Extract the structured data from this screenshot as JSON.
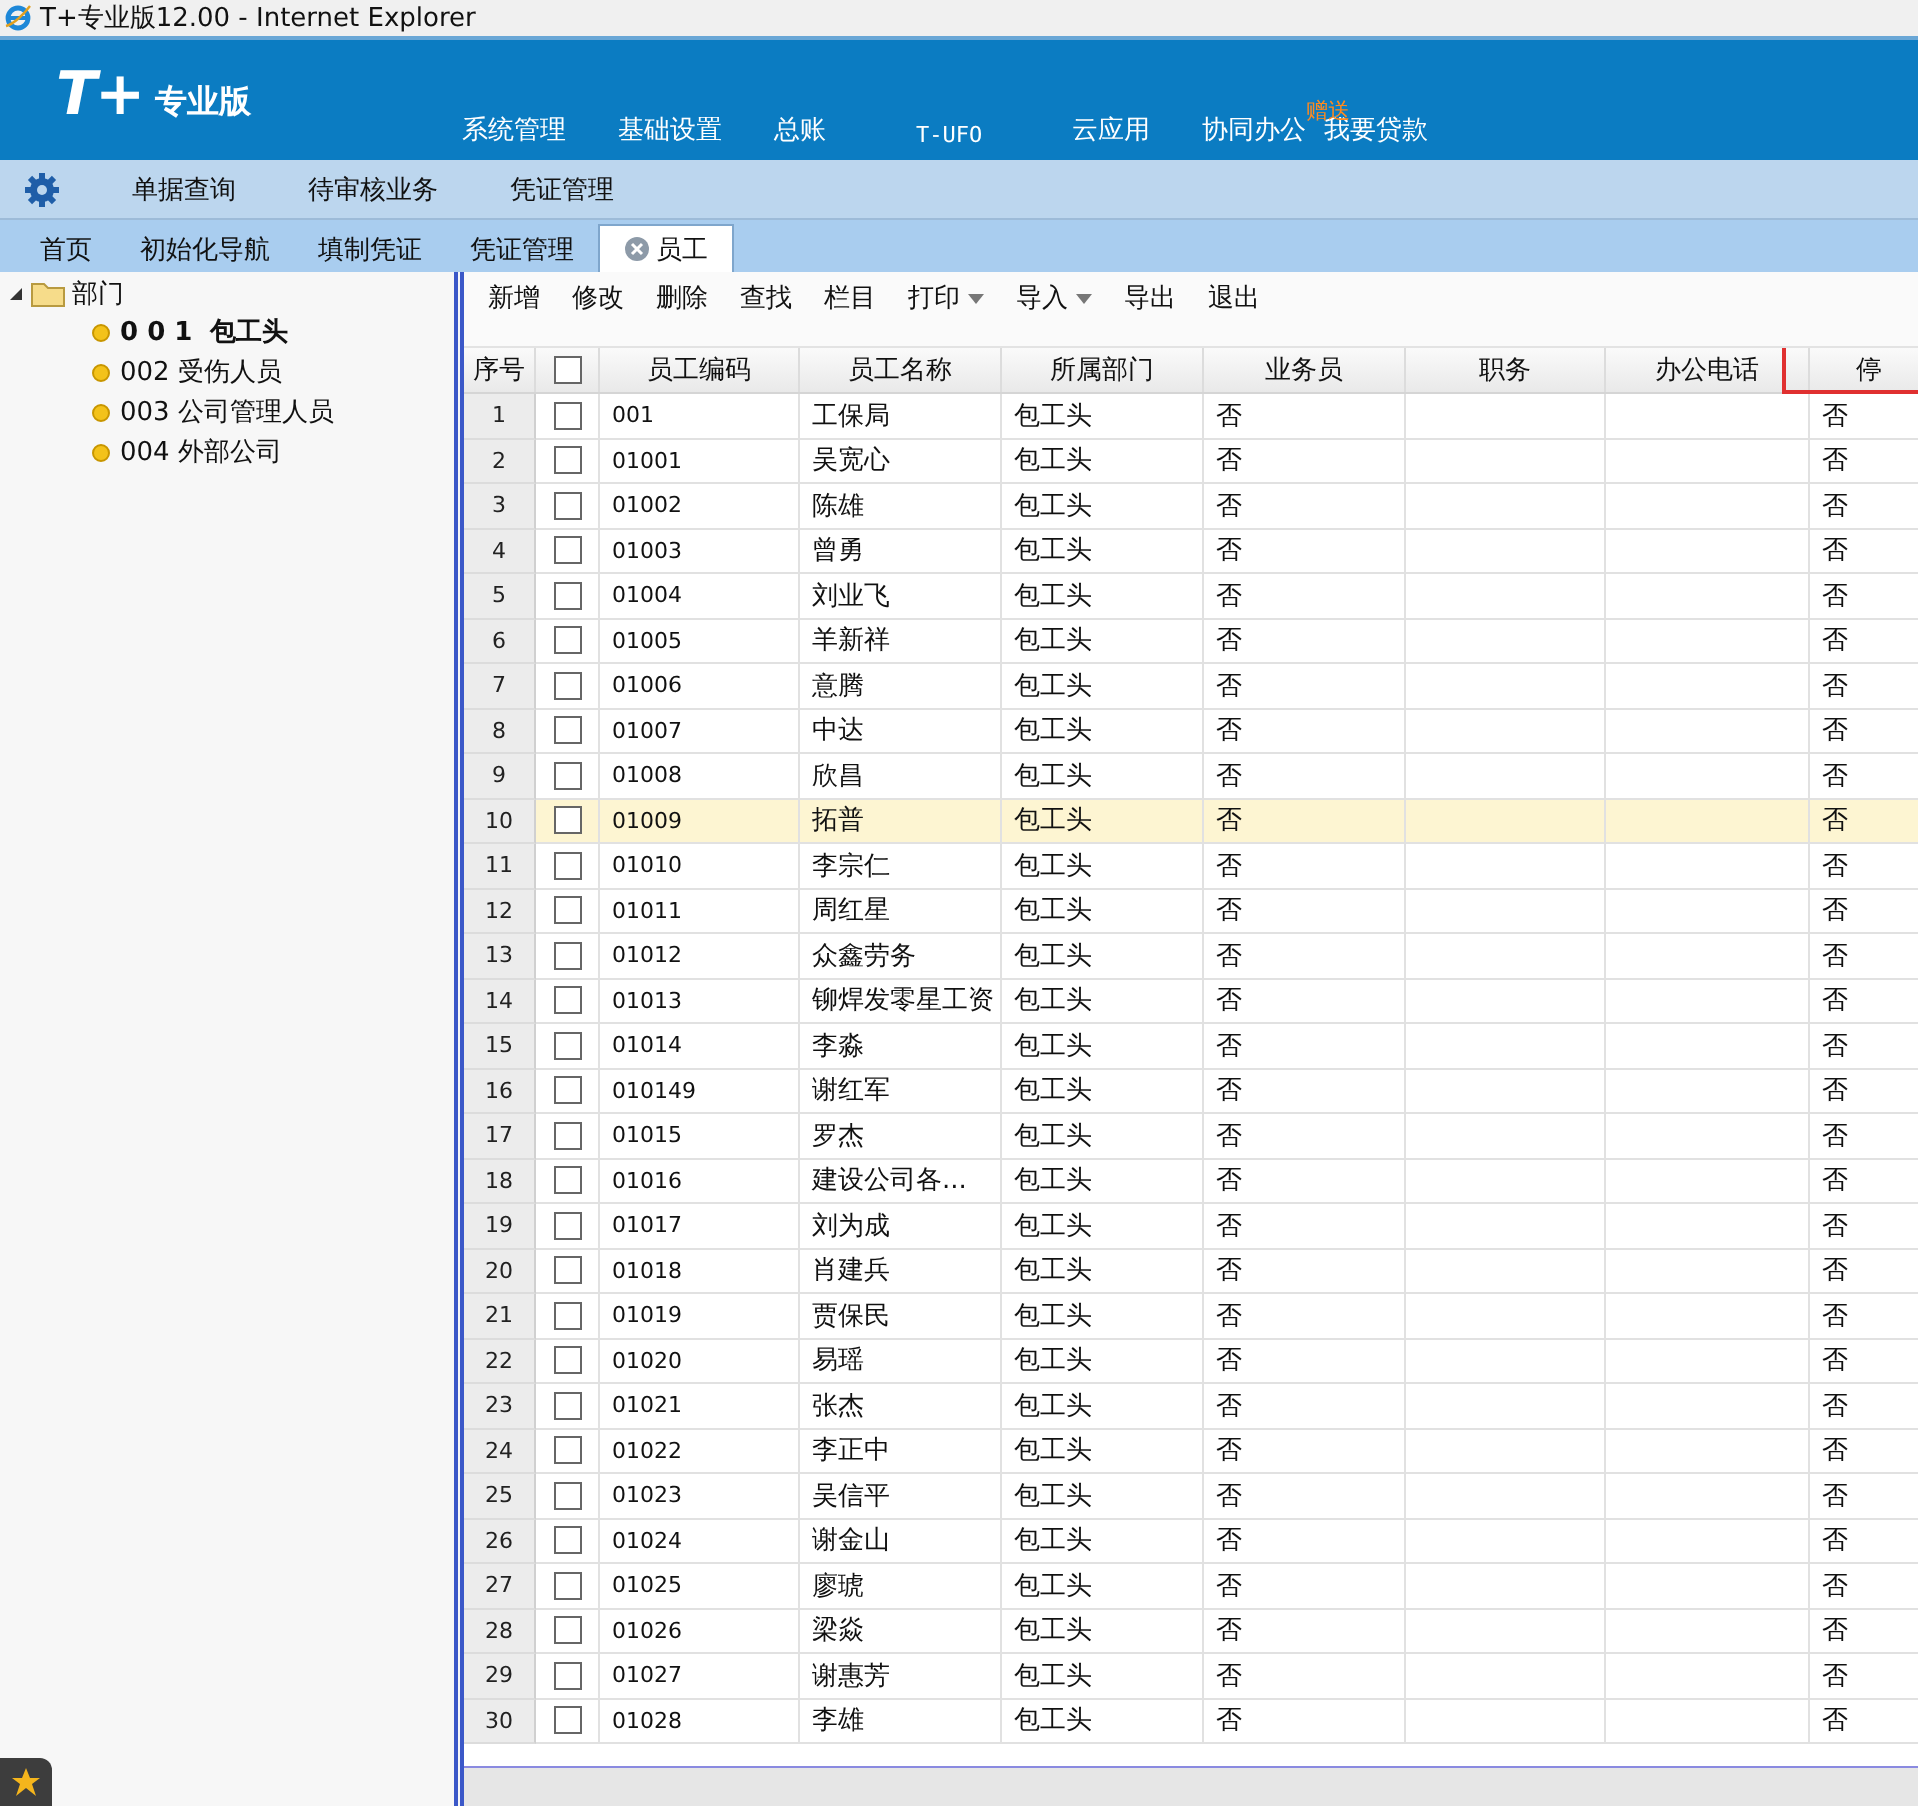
{
  "window": {
    "title": "T+专业版12.00 - Internet Explorer"
  },
  "header": {
    "logo": "T+",
    "edition": "专业版",
    "nav": [
      {
        "label": "系统管理"
      },
      {
        "label": "基础设置"
      },
      {
        "label": "总账"
      },
      {
        "label": "T-UFO",
        "kind": "mono"
      },
      {
        "label": "云应用"
      },
      {
        "label": "协同办公",
        "badge": "赠送"
      },
      {
        "label": "我要贷款"
      }
    ]
  },
  "subnav": [
    "单据查询",
    "待审核业务",
    "凭证管理"
  ],
  "tabs": [
    {
      "label": "首页",
      "selected": false
    },
    {
      "label": "初始化导航",
      "selected": false
    },
    {
      "label": "填制凭证",
      "selected": false
    },
    {
      "label": "凭证管理",
      "selected": false
    },
    {
      "label": "员工",
      "selected": true
    }
  ],
  "tree": {
    "label": "部门",
    "expanded": true,
    "children": [
      {
        "label": "0 0 1  包工头",
        "selected": true
      },
      {
        "label": "002 受伤人员",
        "selected": false
      },
      {
        "label": "003 公司管理人员",
        "selected": false
      },
      {
        "label": "004 外部公司",
        "selected": false
      }
    ]
  },
  "toolbar": [
    {
      "label": "新增"
    },
    {
      "label": "修改"
    },
    {
      "label": "删除"
    },
    {
      "label": "查找"
    },
    {
      "label": "栏目"
    },
    {
      "label": "打印",
      "dropdown": true
    },
    {
      "label": "导入",
      "dropdown": true
    },
    {
      "label": "导出"
    },
    {
      "label": "退出"
    }
  ],
  "table": {
    "columns": [
      "序号",
      "员工编码",
      "员工名称",
      "所属部门",
      "业务员",
      "职务",
      "办公电话",
      "停"
    ],
    "all_checked": false,
    "rows": [
      {
        "no": "1",
        "checked": false,
        "selected": false,
        "code": "001",
        "name": "工保局",
        "dept": "包工头",
        "salesman": "否",
        "col8": "否"
      },
      {
        "no": "2",
        "checked": false,
        "selected": false,
        "code": "01001",
        "name": "吴宽心",
        "dept": "包工头",
        "salesman": "否",
        "col8": "否"
      },
      {
        "no": "3",
        "checked": false,
        "selected": false,
        "code": "01002",
        "name": "陈雄",
        "dept": "包工头",
        "salesman": "否",
        "col8": "否"
      },
      {
        "no": "4",
        "checked": false,
        "selected": false,
        "code": "01003",
        "name": "曾勇",
        "dept": "包工头",
        "salesman": "否",
        "col8": "否"
      },
      {
        "no": "5",
        "checked": false,
        "selected": false,
        "code": "01004",
        "name": "刘业飞",
        "dept": "包工头",
        "salesman": "否",
        "col8": "否"
      },
      {
        "no": "6",
        "checked": false,
        "selected": false,
        "code": "01005",
        "name": "羊新祥",
        "dept": "包工头",
        "salesman": "否",
        "col8": "否"
      },
      {
        "no": "7",
        "checked": false,
        "selected": false,
        "code": "01006",
        "name": "意腾",
        "dept": "包工头",
        "salesman": "否",
        "col8": "否"
      },
      {
        "no": "8",
        "checked": false,
        "selected": false,
        "code": "01007",
        "name": "中达",
        "dept": "包工头",
        "salesman": "否",
        "col8": "否"
      },
      {
        "no": "9",
        "checked": false,
        "selected": false,
        "code": "01008",
        "name": "欣昌",
        "dept": "包工头",
        "salesman": "否",
        "col8": "否"
      },
      {
        "no": "10",
        "checked": false,
        "selected": true,
        "code": "01009",
        "name": "拓普",
        "dept": "包工头",
        "salesman": "否",
        "col8": "否"
      },
      {
        "no": "11",
        "checked": false,
        "selected": false,
        "code": "01010",
        "name": "李宗仁",
        "dept": "包工头",
        "salesman": "否",
        "col8": "否"
      },
      {
        "no": "12",
        "checked": false,
        "selected": false,
        "code": "01011",
        "name": "周红星",
        "dept": "包工头",
        "salesman": "否",
        "col8": "否"
      },
      {
        "no": "13",
        "checked": false,
        "selected": false,
        "code": "01012",
        "name": "众鑫劳务",
        "dept": "包工头",
        "salesman": "否",
        "col8": "否"
      },
      {
        "no": "14",
        "checked": false,
        "selected": false,
        "code": "01013",
        "name": "铆焊发零星工资",
        "dept": "包工头",
        "salesman": "否",
        "col8": "否"
      },
      {
        "no": "15",
        "checked": false,
        "selected": false,
        "code": "01014",
        "name": "李淼",
        "dept": "包工头",
        "salesman": "否",
        "col8": "否"
      },
      {
        "no": "16",
        "checked": false,
        "selected": false,
        "code": "010149",
        "name": "谢红军",
        "dept": "包工头",
        "salesman": "否",
        "col8": "否"
      },
      {
        "no": "17",
        "checked": false,
        "selected": false,
        "code": "01015",
        "name": "罗杰",
        "dept": "包工头",
        "salesman": "否",
        "col8": "否"
      },
      {
        "no": "18",
        "checked": false,
        "selected": false,
        "code": "01016",
        "name": "建设公司各...",
        "dept": "包工头",
        "salesman": "否",
        "col8": "否"
      },
      {
        "no": "19",
        "checked": false,
        "selected": false,
        "code": "01017",
        "name": "刘为成",
        "dept": "包工头",
        "salesman": "否",
        "col8": "否"
      },
      {
        "no": "20",
        "checked": false,
        "selected": false,
        "code": "01018",
        "name": "肖建兵",
        "dept": "包工头",
        "salesman": "否",
        "col8": "否"
      },
      {
        "no": "21",
        "checked": false,
        "selected": false,
        "code": "01019",
        "name": "贾保民",
        "dept": "包工头",
        "salesman": "否",
        "col8": "否"
      },
      {
        "no": "22",
        "checked": false,
        "selected": false,
        "code": "01020",
        "name": "易瑶",
        "dept": "包工头",
        "salesman": "否",
        "col8": "否"
      },
      {
        "no": "23",
        "checked": false,
        "selected": false,
        "code": "01021",
        "name": "张杰",
        "dept": "包工头",
        "salesman": "否",
        "col8": "否"
      },
      {
        "no": "24",
        "checked": false,
        "selected": false,
        "code": "01022",
        "name": "李正中",
        "dept": "包工头",
        "salesman": "否",
        "col8": "否"
      },
      {
        "no": "25",
        "checked": false,
        "selected": false,
        "code": "01023",
        "name": "吴信平",
        "dept": "包工头",
        "salesman": "否",
        "col8": "否"
      },
      {
        "no": "26",
        "checked": false,
        "selected": false,
        "code": "01024",
        "name": "谢金山",
        "dept": "包工头",
        "salesman": "否",
        "col8": "否"
      },
      {
        "no": "27",
        "checked": false,
        "selected": false,
        "code": "01025",
        "name": "廖琥",
        "dept": "包工头",
        "salesman": "否",
        "col8": "否"
      },
      {
        "no": "28",
        "checked": false,
        "selected": false,
        "code": "01026",
        "name": "梁焱",
        "dept": "包工头",
        "salesman": "否",
        "col8": "否"
      },
      {
        "no": "29",
        "checked": false,
        "selected": false,
        "code": "01027",
        "name": "谢惠芳",
        "dept": "包工头",
        "salesman": "否",
        "col8": "否"
      },
      {
        "no": "30",
        "checked": false,
        "selected": false,
        "code": "01028",
        "name": "李雄",
        "dept": "包工头",
        "salesman": "否",
        "col8": "否"
      }
    ]
  }
}
